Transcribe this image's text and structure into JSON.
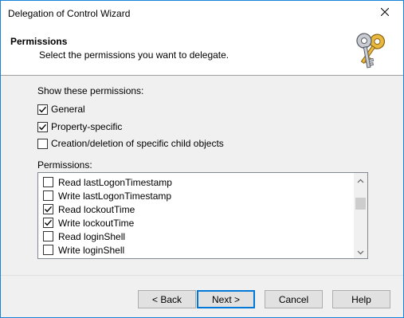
{
  "window": {
    "title": "Delegation of Control Wizard"
  },
  "header": {
    "title": "Permissions",
    "subtitle": "Select the permissions you want to delegate."
  },
  "show_section": {
    "label": "Show these permissions:",
    "options": [
      {
        "label": "General",
        "checked": true
      },
      {
        "label": "Property-specific",
        "checked": true
      },
      {
        "label": "Creation/deletion of specific child objects",
        "checked": false
      }
    ]
  },
  "permissions": {
    "label": "Permissions:",
    "items": [
      {
        "label": "Read lastLogonTimestamp",
        "checked": false
      },
      {
        "label": "Write lastLogonTimestamp",
        "checked": false
      },
      {
        "label": "Read lockoutTime",
        "checked": true
      },
      {
        "label": "Write lockoutTime",
        "checked": true
      },
      {
        "label": "Read loginShell",
        "checked": false
      },
      {
        "label": "Write loginShell",
        "checked": false
      }
    ]
  },
  "buttons": {
    "back": "< Back",
    "next": "Next >",
    "cancel": "Cancel",
    "help": "Help"
  },
  "icons": {
    "close": "close-icon",
    "header": "keys-icon",
    "scroll_up": "chevron-up-icon",
    "scroll_down": "chevron-down-icon"
  },
  "colors": {
    "window_border": "#1883d7",
    "default_button_border": "#0078d7",
    "dialog_background": "#f0f0f0"
  }
}
